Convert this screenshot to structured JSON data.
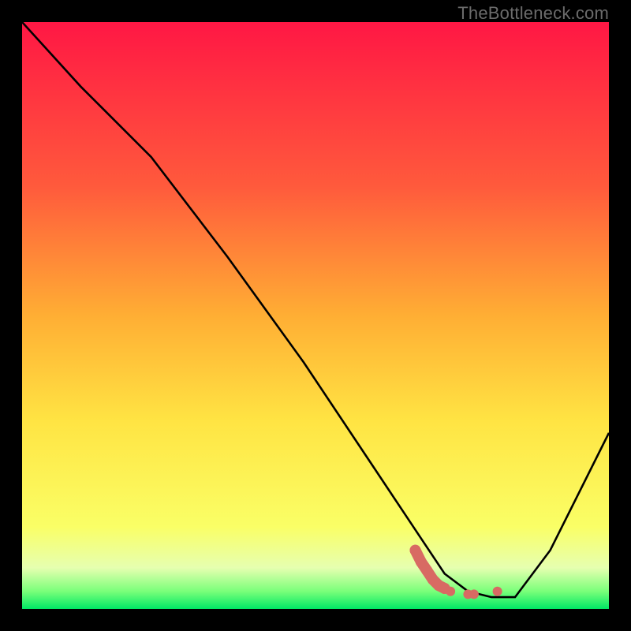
{
  "attribution": "TheBottleneck.com",
  "chart_data": {
    "type": "line",
    "title": "",
    "xlabel": "",
    "ylabel": "",
    "xlim": [
      0,
      100
    ],
    "ylim": [
      0,
      100
    ],
    "grid": false,
    "background": {
      "type": "vertical-gradient",
      "stops": [
        {
          "pos": 0,
          "color": "#ff1744"
        },
        {
          "pos": 28,
          "color": "#ff5a3c"
        },
        {
          "pos": 50,
          "color": "#ffae34"
        },
        {
          "pos": 68,
          "color": "#ffe443"
        },
        {
          "pos": 86,
          "color": "#faff66"
        },
        {
          "pos": 93,
          "color": "#e6ffb0"
        },
        {
          "pos": 97,
          "color": "#7aff7a"
        },
        {
          "pos": 100,
          "color": "#00e865"
        }
      ]
    },
    "series": [
      {
        "name": "bottleneck-curve",
        "color": "#000000",
        "x": [
          0,
          10,
          22,
          35,
          48,
          60,
          68,
          72,
          76,
          80,
          84,
          90,
          100
        ],
        "y": [
          100,
          89,
          77,
          60,
          42,
          24,
          12,
          6,
          3,
          2,
          2,
          10,
          30
        ]
      }
    ],
    "highlight": {
      "name": "optimal-zone",
      "color": "#d86a63",
      "points_x": [
        67,
        68,
        69,
        70,
        71,
        72,
        73,
        76,
        77,
        81
      ],
      "points_y": [
        10,
        8,
        6.5,
        5,
        4,
        3.5,
        3,
        2.5,
        2.5,
        3
      ]
    }
  }
}
